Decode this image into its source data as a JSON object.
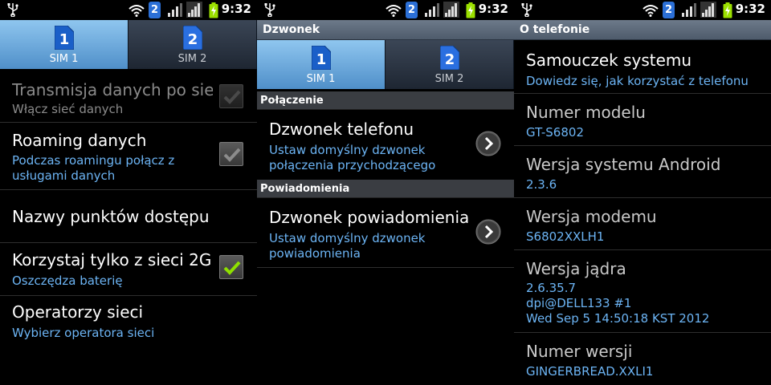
{
  "status": {
    "time": "9:32",
    "sim_badge": "2"
  },
  "screen1": {
    "tabs": [
      {
        "number": "1",
        "label": "SIM 1"
      },
      {
        "number": "2",
        "label": "SIM 2"
      }
    ],
    "items": [
      {
        "title": "Transmisja danych po sieci",
        "subtitle": "Włącz sieć danych",
        "checked": false,
        "enabled": false
      },
      {
        "title": "Roaming danych",
        "subtitle": "Podczas roamingu połącz z usługami danych",
        "checked": false,
        "enabled": true
      },
      {
        "title": "Nazwy punktów dostępu"
      },
      {
        "title": "Korzystaj tylko z sieci 2G",
        "subtitle": "Oszczędza baterię",
        "checked": true,
        "enabled": true
      },
      {
        "title": "Operatorzy sieci",
        "subtitle": "Wybierz operatora sieci"
      }
    ]
  },
  "screen2": {
    "title": "Dzwonek",
    "tabs": [
      {
        "number": "1",
        "label": "SIM 1"
      },
      {
        "number": "2",
        "label": "SIM 2"
      }
    ],
    "section1": "Połączenie",
    "item1": {
      "title": "Dzwonek telefonu",
      "subtitle": "Ustaw domyślny dzwonek połączenia przychodzącego"
    },
    "section2": "Powiadomienia",
    "item2": {
      "title": "Dzwonek powiadomienia",
      "subtitle": "Ustaw domyślny dzwonek powiadomienia"
    }
  },
  "screen3": {
    "title": "O telefonie",
    "items": [
      {
        "title": "Samouczek systemu",
        "value": "Dowiedz się, jak korzystać z telefonu"
      },
      {
        "title": "Numer modelu",
        "value": "GT-S6802"
      },
      {
        "title": "Wersja systemu Android",
        "value": "2.3.6"
      },
      {
        "title": "Wersja modemu",
        "value": "S6802XXLH1"
      },
      {
        "title": "Wersja jądra",
        "value_lines": [
          "2.6.35.7",
          "dpi@DELL133 #1",
          "Wed Sep 5 14:50:18 KST 2012"
        ]
      },
      {
        "title": "Numer wersji",
        "value": "GINGERBREAD.XXLI1"
      }
    ]
  },
  "colors": {
    "accent_blue": "#6cb4f4",
    "check_green": "#8ee000",
    "tab_active": "#4f8fc9"
  }
}
